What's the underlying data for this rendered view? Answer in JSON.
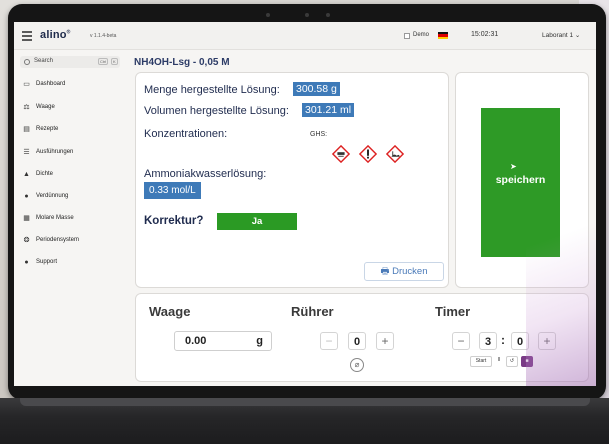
{
  "app": {
    "logo": "alino",
    "logo_mark": "®",
    "version": "v 1.1.4-beta",
    "demo_label": "Demo",
    "clock": "15:02:31",
    "user": "Laborant 1",
    "user_chevron": "⌄"
  },
  "sidebar": {
    "search_label": "Search",
    "search_kbd1": "Ctrl",
    "search_kbd2": "K",
    "items": [
      {
        "label": "Dashboard",
        "icon": "▭"
      },
      {
        "label": "Waage",
        "icon": "⚖"
      },
      {
        "label": "Rezepte",
        "icon": "▤"
      },
      {
        "label": "Ausführungen",
        "icon": "☰"
      },
      {
        "label": "Dichte",
        "icon": "▲"
      },
      {
        "label": "Verdünnung",
        "icon": "●"
      },
      {
        "label": "Molare Masse",
        "icon": "▦"
      },
      {
        "label": "Periodensystem",
        "icon": "❂"
      },
      {
        "label": "Support",
        "icon": "●"
      }
    ]
  },
  "main": {
    "title": "NH4OH-Lsg - 0,05 M",
    "mass_label": "Menge hergestellte Lösung:",
    "mass_value": "300.58 g",
    "volume_label": "Volumen hergestellte Lösung:",
    "volume_value": "301.21 ml",
    "concentrations_label": "Konzentrationen:",
    "ghs_label": "GHS:",
    "ghs_icons": [
      "ghs05-corrosive-icon",
      "ghs07-exclamation-icon",
      "ghs09-environment-icon"
    ],
    "compound_label": "Ammoniakwasserlösung:",
    "compound_value": "0.33 mol/L",
    "correction_label": "Korrektur?",
    "correction_button": "Ja",
    "print_button": "Drucken",
    "save_button": "speichern"
  },
  "bottom": {
    "scale_title": "Waage",
    "scale_value": "0.00",
    "scale_unit": "g",
    "stirrer_title": "Rührer",
    "stirrer_minus": "−",
    "stirrer_value": "0",
    "stirrer_plus": "+",
    "timer_title": "Timer",
    "timer_minus": "−",
    "timer_minutes": "3",
    "timer_colon": ":",
    "timer_seconds": "0",
    "timer_plus": "+",
    "timer_start": "Start",
    "timer_pause": "II",
    "timer_reset": "↺",
    "timer_stop": "■"
  },
  "colors": {
    "accent_blue": "#3e7ab8",
    "green": "#2e9a26",
    "title_navy": "#2c3b66",
    "purple": "#7a3a86"
  }
}
